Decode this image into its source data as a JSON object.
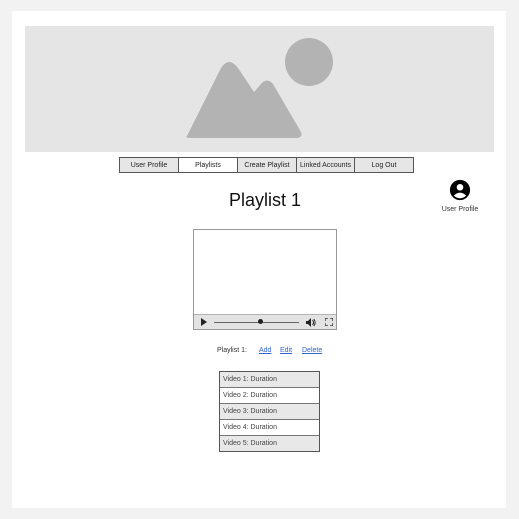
{
  "nav": {
    "items": [
      {
        "label": "User Profile",
        "active": false
      },
      {
        "label": "Playlists",
        "active": true
      },
      {
        "label": "Create Playlist",
        "active": false
      },
      {
        "label": "Linked Accounts",
        "active": false
      },
      {
        "label": "Log Out",
        "active": false
      }
    ]
  },
  "user_profile": {
    "label": "User Profile",
    "icon": "account-circle-icon"
  },
  "page": {
    "title": "Playlist 1"
  },
  "player": {
    "progress": 0.55,
    "icons": [
      "play-icon",
      "volume-icon",
      "fullscreen-icon"
    ]
  },
  "actions": {
    "prefix": "Playlist 1:",
    "add": "Add",
    "edit": "Edit",
    "delete": "Delete"
  },
  "videos": [
    "Video 1: Duration",
    "Video 2: Duration",
    "Video 3: Duration",
    "Video 4: Duration",
    "Video 5: Duration"
  ],
  "colors": {
    "banner": "#e5e5e5",
    "placeholder_shape": "#b3b3b3",
    "link": "#3366cc",
    "row_alt": "#e8e8e8"
  }
}
